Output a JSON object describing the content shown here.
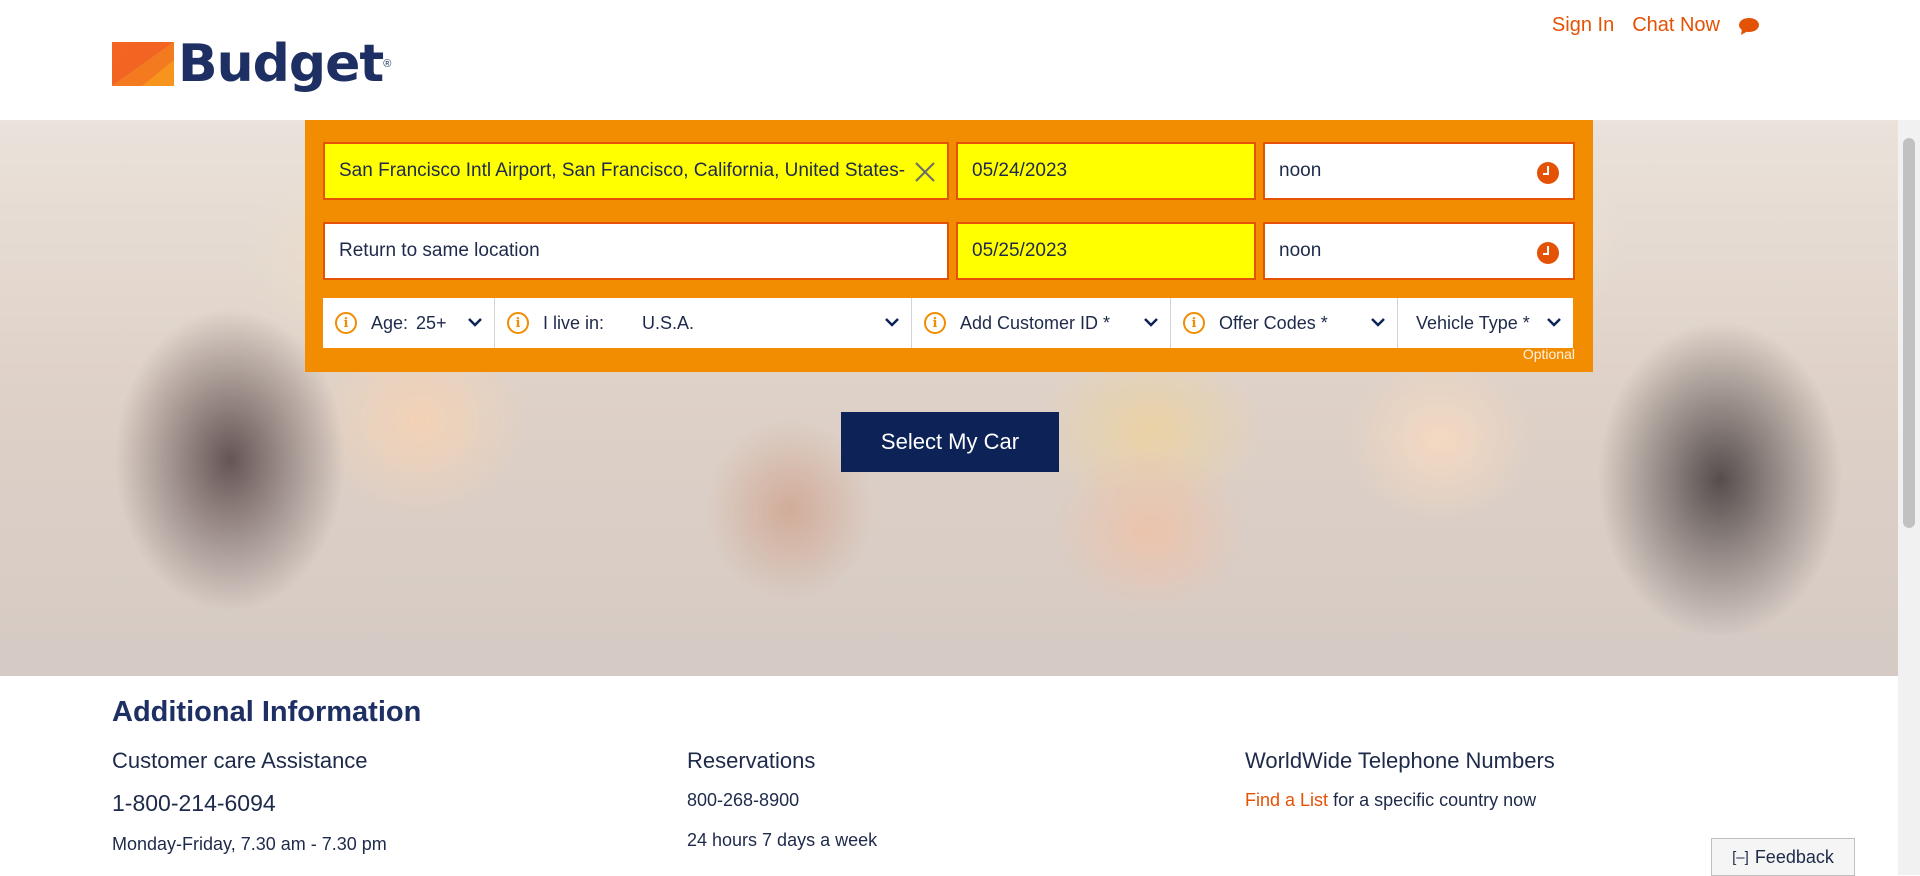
{
  "header": {
    "brand": "Budget",
    "brand_mark": "®",
    "sign_in": "Sign In",
    "chat_now": "Chat Now"
  },
  "booking": {
    "pickup_location": "San Francisco Intl Airport, San Francisco, California, United States-",
    "pickup_date": "05/24/2023",
    "pickup_time": "noon",
    "return_location": "Return to same location",
    "return_date": "05/25/2023",
    "return_time": "noon",
    "age_label": "Age:",
    "age_value": "25+",
    "live_in_label": "I live in:",
    "live_in_value": "U.S.A.",
    "customer_id": "Add Customer ID *",
    "offer_codes": "Offer Codes *",
    "vehicle_type": "Vehicle Type *",
    "optional_note": "Optional",
    "submit": "Select My Car"
  },
  "info": {
    "title": "Additional Information",
    "customer_care": {
      "heading": "Customer care Assistance",
      "phone": "1-800-214-6094",
      "hours": "Monday-Friday, 7.30 am - 7.30 pm"
    },
    "reservations": {
      "heading": "Reservations",
      "phone": "800-268-8900",
      "hours": "24 hours 7 days a week"
    },
    "worldwide": {
      "heading": "WorldWide Telephone Numbers",
      "link": "Find a List",
      "suffix": "for a specific country now"
    }
  },
  "feedback": {
    "toggle": "[–]",
    "label": "Feedback"
  },
  "colors": {
    "accent": "#e35205",
    "booking_bg": "#f28c00",
    "highlight": "#ffff00",
    "navy": "#0d2357"
  }
}
